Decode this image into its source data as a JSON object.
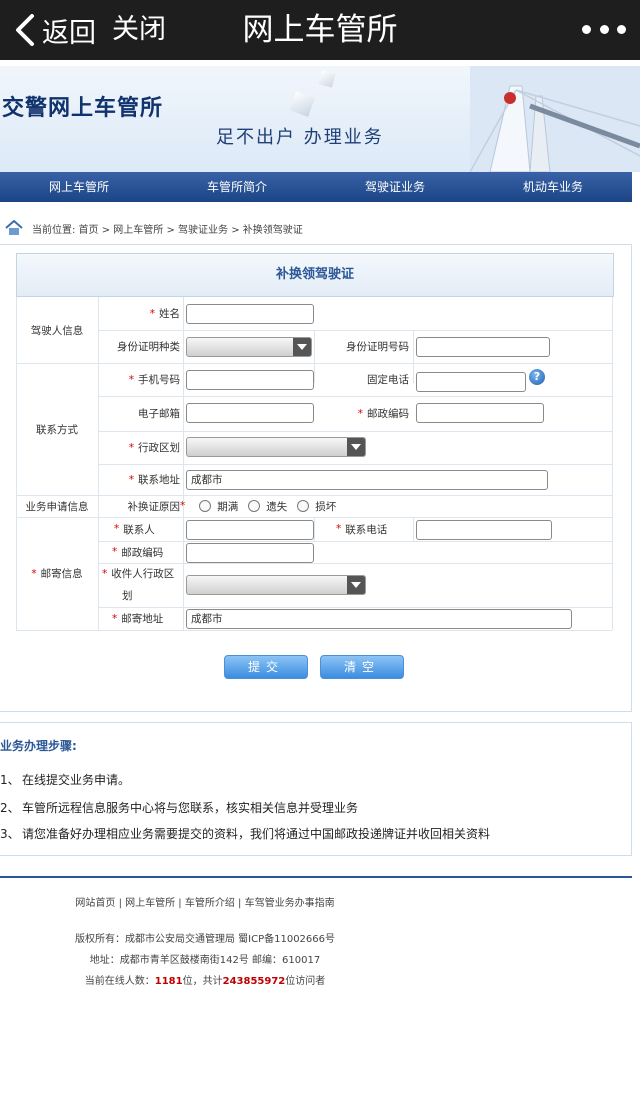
{
  "topbar": {
    "back_label": "返回",
    "close_label": "关闭",
    "title": "网上车管所"
  },
  "banner": {
    "site_title": "交警网上车管所",
    "slogan": "足不出户  办理业务"
  },
  "nav": [
    "网上车管所",
    "车管所简介",
    "驾驶证业务",
    "机动车业务"
  ],
  "breadcrumb": "当前位置:  首页 > 网上车管所 > 驾驶证业务 > 补换领驾驶证",
  "form": {
    "title": "补换领驾驶证",
    "section_driver": "驾驶人信息",
    "section_contact": "联系方式",
    "section_apply": "业务申请信息",
    "section_mail": "邮寄信息",
    "name_label": "姓名",
    "id_type_label": "身份证明种类",
    "id_no_label": "身份证明号码",
    "mobile_label": "手机号码",
    "phone_label": "固定电话",
    "email_label": "电子邮箱",
    "postcode_label": "邮政编码",
    "region_label": "行政区划",
    "address_label": "联系地址",
    "address_value": "成都市",
    "reason_label": "补换证原因",
    "reasons": [
      "期满",
      "遗失",
      "损坏"
    ],
    "contact_label": "联系人",
    "contact_phone_label": "联系电话",
    "mail_postcode_label": "邮政编码",
    "recv_region_label_1": "收件人行政区",
    "recv_region_label_2": "划",
    "mail_address_label": "邮寄地址",
    "mail_address_value": "成都市",
    "required_mark": "*",
    "help_glyph": "?"
  },
  "buttons": {
    "submit": "提交",
    "clear": "清空"
  },
  "steps": {
    "heading": "业务办理步骤:",
    "items": [
      {
        "n": "1、",
        "text": "在线提交业务申请。"
      },
      {
        "n": "2、",
        "text": "车管所远程信息服务中心将与您联系，核实相关信息并受理业务"
      },
      {
        "n": "3、",
        "text": "请您准备好办理相应业务需要提交的资料，我们将通过中国邮政投递牌证并收回相关资料"
      }
    ]
  },
  "footer": {
    "links": "网站首页 | 网上车管所 | 车管所介绍 | 车驾管业务办事指南",
    "copyright": "版权所有：成都市公安局交通管理局 蜀ICP备11002666号",
    "address": "地址：成都市青羊区鼓楼南街142号 邮编：610017",
    "online_prefix": "当前在线人数：",
    "online_count": "1181",
    "online_mid": "位，共计",
    "visits": "243855972",
    "online_suffix": "位访问者"
  },
  "colors": {
    "accent": "#2b5797",
    "nav_bg": "#1c4586",
    "topbar_bg": "#1e1e1e",
    "required": "#d60000",
    "count": "#c00000",
    "button": "#3b8de0"
  },
  "icons": {
    "back": "chevron-left-icon",
    "more": "more-dots-icon",
    "home": "home-icon",
    "help": "help-icon",
    "dropdown": "dropdown-arrow-icon"
  }
}
